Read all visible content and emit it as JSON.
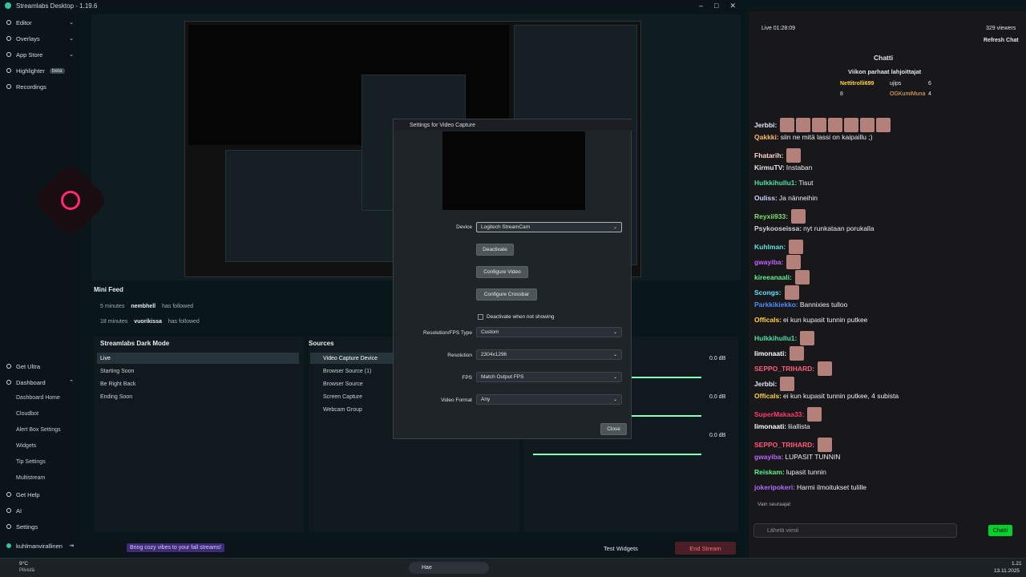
{
  "app": {
    "title": "Streamlabs Desktop - 1.19.6"
  },
  "sidebar": {
    "top": [
      {
        "label": "Editor"
      },
      {
        "label": "Overlays"
      },
      {
        "label": "App Store"
      },
      {
        "label": "Highlighter",
        "badge": "beta"
      },
      {
        "label": "Recordings"
      }
    ],
    "bottom": [
      {
        "label": "Get Ultra"
      },
      {
        "label": "Dashboard"
      }
    ],
    "dash_items": [
      "Dashboard Home",
      "Cloudbot",
      "Alert Box Settings",
      "Widgets",
      "Tip Settings",
      "Multistream"
    ],
    "footer": [
      {
        "label": "Get Help"
      },
      {
        "label": "AI"
      },
      {
        "label": "Settings"
      }
    ],
    "user": "kuhlmanvirallinen"
  },
  "minifeed": {
    "title": "Mini Feed",
    "rows": [
      {
        "time": "5 minutes",
        "user": "nembhell",
        "action": "has followed"
      },
      {
        "time": "18 minutes",
        "user": "vuorikissa",
        "action": "has followed"
      }
    ]
  },
  "scenes": {
    "title": "Streamlabs Dark Mode",
    "items": [
      "Live",
      "Starting Soon",
      "Be Right Back",
      "Ending Soon"
    ]
  },
  "sources": {
    "title": "Sources",
    "items": [
      "Video Capture Device",
      "Browser Source (1)",
      "Browser Source",
      "Screen Capture",
      "Webcam Group"
    ]
  },
  "mixer": {
    "levels": [
      "0.0 dB",
      "0.0 dB",
      "0.0 dB"
    ]
  },
  "bottom": {
    "promo": "Bring cozy vibes to your fall streams!",
    "test": "Test Widgets",
    "end": "End Stream"
  },
  "dialog": {
    "title": "Settings for Video Capture",
    "device_label": "Device",
    "device": "Logitech StreamCam",
    "btn_deactivate": "Deactivate",
    "btn_config_video": "Configure Video",
    "btn_config_crossbar": "Configure Crossbar",
    "chk": "Deactivate when not showing",
    "res_fps_label": "Resolution/FPS Type",
    "res_fps": "Custom",
    "res_label": "Resolution",
    "res": "2304x1296",
    "fps_label": "FPS",
    "fps": "Match Output FPS",
    "vf_label": "Video Format",
    "vf": "Any",
    "close": "Close"
  },
  "chat": {
    "live": "Live 01:28:09",
    "viewers": "329 viewers",
    "refresh": "Refresh Chat",
    "title": "Chatti",
    "top_title": "Viikon parhaat lahjoittajat",
    "top": [
      {
        "name": "Nettitrolli699",
        "n": "8"
      },
      {
        "name": "ujips",
        "n": "6"
      },
      {
        "name": "OGKumiMuna",
        "n": "4"
      }
    ],
    "messages": [
      {
        "u": "Jerbbi:",
        "t": "",
        "c": "#e6e6ff",
        "e": 7
      },
      {
        "u": "Qakkki:",
        "t": "siin ne mitä lassi on kaipaillu ;)",
        "c": "#ffb86b",
        "e": 0
      },
      {
        "u": "Fhatarih:",
        "t": "",
        "c": "#ffd4c8",
        "e": 1
      },
      {
        "u": "KirmuTV:",
        "t": "Instaban",
        "c": "#e6e6e6",
        "e": 0
      },
      {
        "u": "Hulkkihullu1:",
        "t": "Tisut",
        "c": "#47e0a8",
        "e": 0
      },
      {
        "u": "Ouliss:",
        "t": "Ja nänneihin",
        "c": "#c9d2ff",
        "e": 0
      },
      {
        "u": "Reyxii933:",
        "t": "",
        "c": "#7ee36b",
        "e": 1
      },
      {
        "u": "Psykooseissa:",
        "t": "nyt runkataan porukalla",
        "c": "#d4d4d4",
        "e": 0
      },
      {
        "u": "Kuhlman:",
        "t": "",
        "c": "#5ee2e6",
        "e": 1
      },
      {
        "u": "gwayiba:",
        "t": "",
        "c": "#c262ff",
        "e": 1
      },
      {
        "u": "kireeanaali:",
        "t": "",
        "c": "#5ef08d",
        "e": 1
      },
      {
        "u": "Scongs:",
        "t": "",
        "c": "#5ee2ff",
        "e": 1
      },
      {
        "u": "Parkkikiekko:",
        "t": "Bannixies tulloo",
        "c": "#4e8cff",
        "e": 0
      },
      {
        "u": "Officals:",
        "t": "ei kun kupasit tunnin putkee",
        "c": "#ffd23d",
        "e": 0
      },
      {
        "u": "Hulkkihullu1:",
        "t": "",
        "c": "#47e0a8",
        "e": 1
      },
      {
        "u": "limonaati:",
        "t": "",
        "c": "#ffffff",
        "e": 1
      },
      {
        "u": "SEPPO_TRIHARD:",
        "t": "",
        "c": "#ff5a7a",
        "e": 1
      },
      {
        "u": "Jerbbi:",
        "t": "",
        "c": "#e6e6ff",
        "e": 1
      },
      {
        "u": "Officals:",
        "t": "ei kun kupasit tunnin putkee, 4 subista",
        "c": "#ffd23d",
        "e": 0
      },
      {
        "u": "SuperMakaa33:",
        "t": "",
        "c": "#ff3a6a",
        "e": 1
      },
      {
        "u": "limonaati:",
        "t": "liiallista",
        "c": "#ffffff",
        "e": 0
      },
      {
        "u": "SEPPO_TRIHARD:",
        "t": "",
        "c": "#ff5a7a",
        "e": 1
      },
      {
        "u": "gwayiba:",
        "t": "LUPASIT TUNNIN",
        "c": "#c262ff",
        "e": 0
      },
      {
        "u": "Reiskam:",
        "t": "lupasit tunnin",
        "c": "#5ef08d",
        "e": 0
      },
      {
        "u": "jokeripokeri:",
        "t": "Harmi ilmoitukset tulille",
        "c": "#b46bff",
        "e": 0
      }
    ],
    "followers_only": "Vain seuraajat",
    "placeholder": "Lähetä viesti",
    "send": "Chatti"
  },
  "taskbar": {
    "weather": "9°C",
    "weather2": "Pilvistä",
    "search": "Hae",
    "time": "1.21",
    "date": "13.11.2025"
  }
}
